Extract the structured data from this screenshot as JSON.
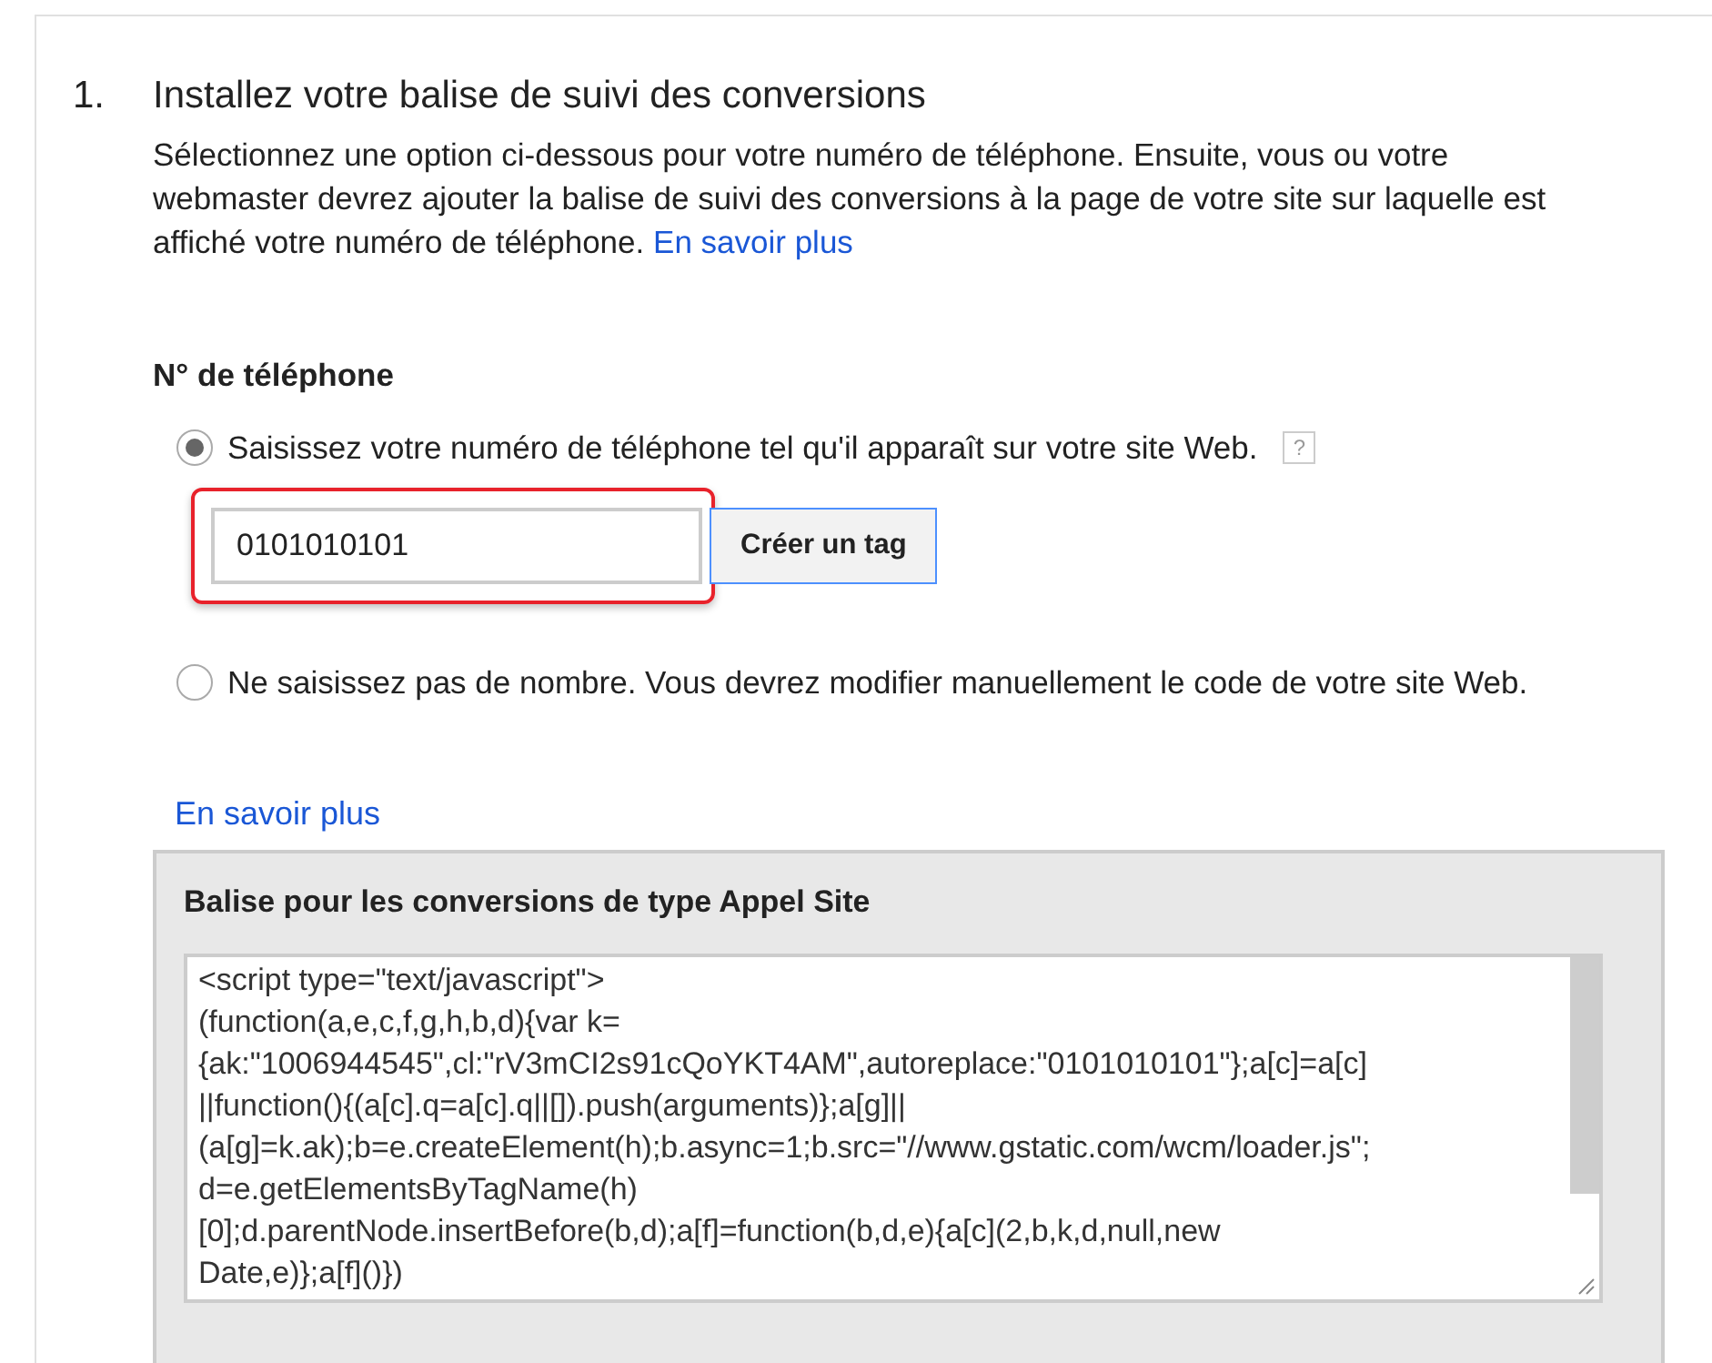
{
  "step": {
    "number": "1.",
    "title": "Installez votre balise de suivi des conversions"
  },
  "intro": {
    "text": "Sélectionnez une option ci-dessous pour votre numéro de téléphone. Ensuite, vous ou votre webmaster devrez ajouter la balise de suivi des conversions à la page de votre site sur laquelle est affiché votre numéro de téléphone.",
    "link": "En savoir plus"
  },
  "phone_section": {
    "heading": "N° de téléphone"
  },
  "options": [
    {
      "label": "Saisissez votre numéro de téléphone tel qu'il apparaît sur votre site Web.",
      "selected": true,
      "help": "?",
      "field": {
        "value": "0101010101",
        "highlighted": true
      },
      "button": "Créer un tag"
    },
    {
      "label": "Ne saisissez pas de nombre. Vous devrez modifier manuellement le code de votre site Web.",
      "selected": false
    }
  ],
  "learn_more": "En savoir plus",
  "tag_panel": {
    "title": "Balise pour les conversions de type Appel Site",
    "code_lines": [
      "<script type=\"text/javascript\">",
      "(function(a,e,c,f,g,h,b,d){var k=",
      "{ak:\"1006944545\",cl:\"rV3mCI2s91cQoYKT4AM\",autoreplace:\"0101010101\"};a[c]=a[c]",
      "||function(){(a[c].q=a[c].q||[]).push(arguments)};a[g]||",
      "(a[g]=k.ak);b=e.createElement(h);b.async=1;b.src=\"//www.gstatic.com/wcm/loader.js\";",
      "d=e.getElementsByTagName(h)",
      "[0];d.parentNode.insertBefore(b,d);a[f]=function(b,d,e){a[c](2,b,k,d,null,new",
      "Date,e)};a[f]()})"
    ]
  }
}
